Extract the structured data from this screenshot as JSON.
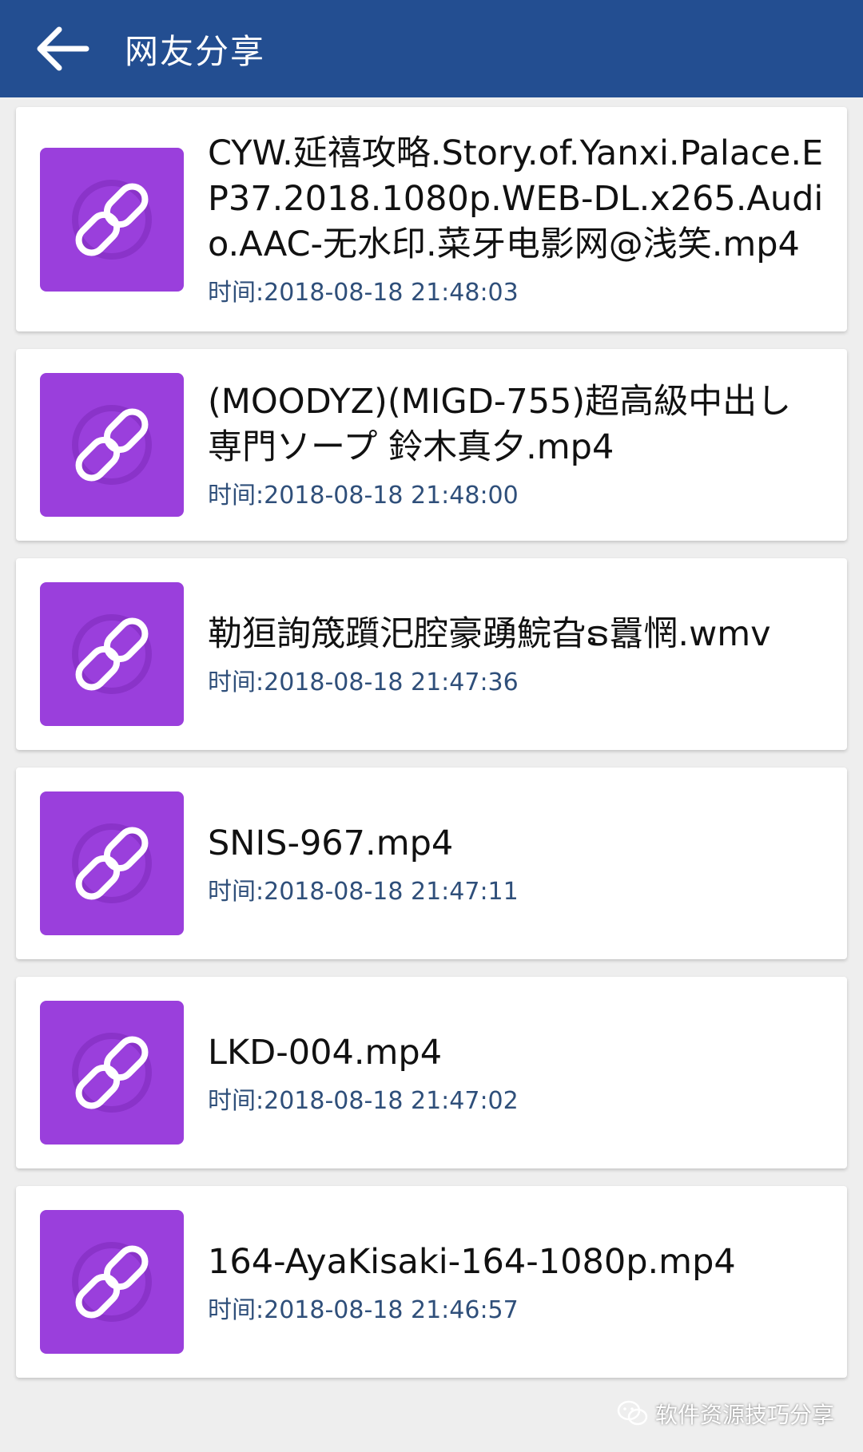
{
  "header": {
    "title": "网友分享",
    "back_icon": "arrow-left-icon"
  },
  "colors": {
    "header_bg": "#234e91",
    "thumb_bg": "#9a3fdc",
    "time_text": "#2f4f7a"
  },
  "items": [
    {
      "name": "CYW.延禧攻略.Story.of.Yanxi.Palace.EP37.2018.1080p.WEB-DL.x265.Audio.AAC-无水印.菜牙电影网@浅笑.mp4",
      "time": "时间:2018-08-18 21:48:03",
      "icon": "link-icon"
    },
    {
      "name": "(MOODYZ)(MIGD-755)超高級中出し専門ソープ 鈴木真夕.mp4",
      "time": "时间:2018-08-18 21:48:00",
      "icon": "link-icon"
    },
    {
      "name": "勒狟詢筬躓汜腔豪踴鯇旮ຣ囂惘.wmv",
      "time": "时间:2018-08-18 21:47:36",
      "icon": "link-icon"
    },
    {
      "name": "SNIS-967.mp4",
      "time": "时间:2018-08-18 21:47:11",
      "icon": "link-icon"
    },
    {
      "name": "LKD-004.mp4",
      "time": "时间:2018-08-18 21:47:02",
      "icon": "link-icon"
    },
    {
      "name": "164-AyaKisaki-164-1080p.mp4",
      "time": "时间:2018-08-18 21:46:57",
      "icon": "link-icon"
    }
  ],
  "watermark": {
    "text": "软件资源技巧分享",
    "icon": "wechat-icon"
  }
}
